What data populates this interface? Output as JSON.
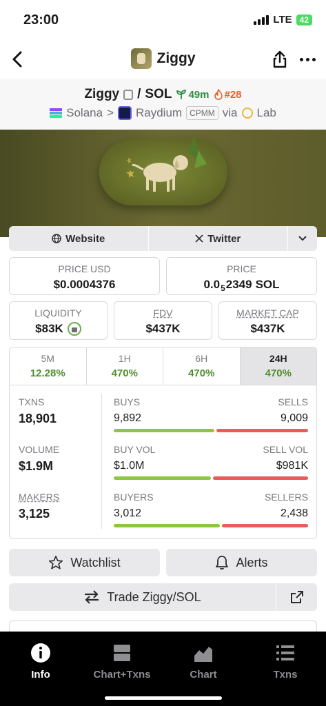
{
  "status_bar": {
    "time": "23:00",
    "network": "LTE",
    "battery": "42"
  },
  "nav": {
    "title": "Ziggy"
  },
  "pair": {
    "base": "Ziggy",
    "separator": "/",
    "quote": "SOL",
    "age": "49m",
    "rank": "#28"
  },
  "route": {
    "chain": "Solana",
    "arrow": ">",
    "dex": "Raydium",
    "type": "CPMM",
    "via": "via",
    "source": "Lab"
  },
  "links": {
    "website": "Website",
    "twitter": "Twitter"
  },
  "price_usd": {
    "label": "PRICE USD",
    "value": "$0.0004376"
  },
  "price_native": {
    "label": "PRICE",
    "prefix": "0.0",
    "zeros": "5",
    "digits": "2349",
    "unit": "SOL"
  },
  "liquidity": {
    "label": "LIQUIDITY",
    "value": "$83K"
  },
  "fdv": {
    "label": "FDV",
    "value": "$437K"
  },
  "market_cap": {
    "label": "MARKET CAP",
    "value": "$437K"
  },
  "periods": [
    {
      "label": "5M",
      "value": "12.28%"
    },
    {
      "label": "1H",
      "value": "470%"
    },
    {
      "label": "6H",
      "value": "470%"
    },
    {
      "label": "24H",
      "value": "470%"
    }
  ],
  "stats": {
    "txns": {
      "label": "TXNS",
      "value": "18,901"
    },
    "volume": {
      "label": "VOLUME",
      "value": "$1.9M"
    },
    "makers": {
      "label": "MAKERS",
      "value": "3,125"
    },
    "buys": {
      "label": "BUYS",
      "value": "9,892",
      "ratio": 0.523
    },
    "sells": {
      "label": "SELLS",
      "value": "9,009"
    },
    "buy_vol": {
      "label": "BUY VOL",
      "value": "$1.0M",
      "ratio": 0.505
    },
    "sell_vol": {
      "label": "SELL VOL",
      "value": "$981K"
    },
    "buyers": {
      "label": "BUYERS",
      "value": "3,012",
      "ratio": 0.553
    },
    "sellers": {
      "label": "SELLERS",
      "value": "2,438"
    }
  },
  "actions": {
    "watchlist": "Watchlist",
    "alerts": "Alerts",
    "trade": "Trade Ziggy/SOL"
  },
  "tabbar": [
    {
      "label": "Info",
      "icon": "info-icon"
    },
    {
      "label": "Chart+Txns",
      "icon": "chart-txns-icon"
    },
    {
      "label": "Chart",
      "icon": "chart-icon"
    },
    {
      "label": "Txns",
      "icon": "list-icon"
    }
  ],
  "colors": {
    "positive": "#4e8f2a",
    "buy": "#8dc63f",
    "sell": "#ec5a5a",
    "age": "#2e8b3e",
    "rank": "#e0652b"
  }
}
